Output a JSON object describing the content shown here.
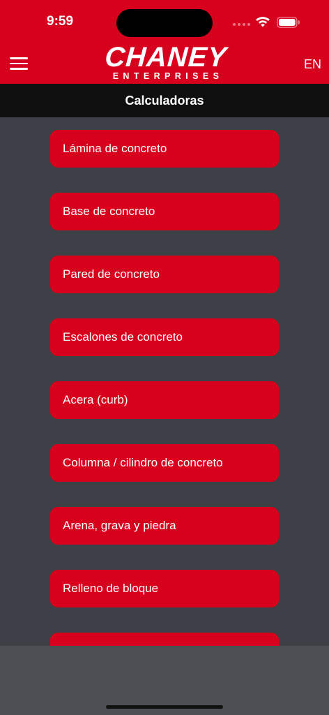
{
  "status_bar": {
    "time": "9:59"
  },
  "header": {
    "logo_main": "CHANEY",
    "logo_sub": "ENTERPRISES",
    "language_toggle": "EN"
  },
  "subheader": {
    "title": "Calculadoras"
  },
  "calculators": [
    "Lámina de concreto",
    "Base de concreto",
    "Pared de concreto",
    "Escalones de concreto",
    "Acera (curb)",
    "Columna / cilindro de concreto",
    "Arena, grava y piedra",
    "Relleno de bloque",
    ""
  ],
  "colors": {
    "brand_red": "#d7001d",
    "content_bg": "#3d4046",
    "subheader_bg": "#0f0f10",
    "bottom_bar_bg": "#4c4f54"
  },
  "icons": [
    "hamburger-menu-icon",
    "wifi-icon",
    "battery-icon"
  ]
}
